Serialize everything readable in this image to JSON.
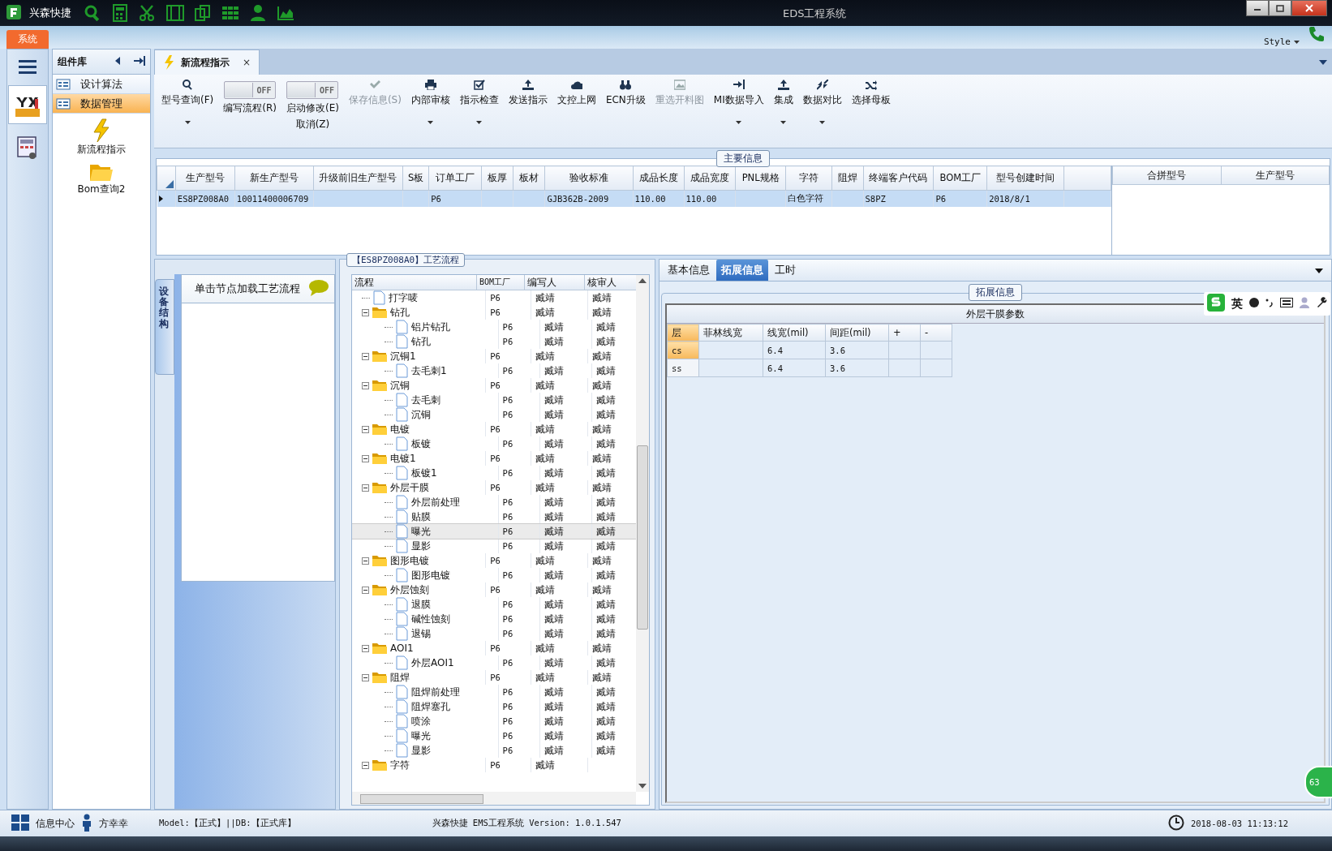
{
  "window": {
    "app_name": "兴森快捷",
    "title": "EDS工程系统"
  },
  "ribbon": {
    "tab": "系统",
    "style_label": "Style"
  },
  "component_panel": {
    "title": "组件库",
    "items": [
      {
        "label": "设计算法",
        "selected": false
      },
      {
        "label": "数据管理",
        "selected": true
      }
    ],
    "tools": [
      {
        "label": "新流程指示"
      },
      {
        "label": "Bom查询2"
      }
    ]
  },
  "doc_tab": {
    "label": "新流程指示",
    "close": "×"
  },
  "toolbar": [
    {
      "kind": "button",
      "label": "型号查询(F)",
      "disabled": false,
      "dropdown": true
    },
    {
      "kind": "toggle",
      "label": "编写流程(R)",
      "toggle_text": "OFF",
      "on": false
    },
    {
      "kind": "toggle",
      "label": "启动修改(E)",
      "label2": "取消(Z)",
      "toggle_text": "OFF",
      "on": false
    },
    {
      "kind": "button",
      "label": "保存信息(S)",
      "disabled": true,
      "dropdown": false
    },
    {
      "kind": "button",
      "label": "内部审核",
      "disabled": false,
      "dropdown": true
    },
    {
      "kind": "button",
      "label": "指示检查",
      "disabled": false,
      "dropdown": true
    },
    {
      "kind": "button",
      "label": "发送指示",
      "disabled": false,
      "dropdown": false
    },
    {
      "kind": "button",
      "label": "文控上网",
      "disabled": false,
      "dropdown": false
    },
    {
      "kind": "button",
      "label": "ECN升级",
      "disabled": false,
      "dropdown": false
    },
    {
      "kind": "button",
      "label": "重选开料图",
      "disabled": true,
      "dropdown": false
    },
    {
      "kind": "button",
      "label": "MI数据导入",
      "disabled": false,
      "dropdown": true
    },
    {
      "kind": "button",
      "label": "集成",
      "disabled": false,
      "dropdown": true
    },
    {
      "kind": "button",
      "label": "数据对比",
      "disabled": false,
      "dropdown": true
    },
    {
      "kind": "button",
      "label": "选择母板",
      "disabled": false,
      "dropdown": false
    }
  ],
  "main_info": {
    "title": "主要信息",
    "columns": [
      "生产型号",
      "新生产型号",
      "升级前旧生产型号",
      "S板",
      "订单工厂",
      "板厚",
      "板材",
      "验收标准",
      "成品长度",
      "成品宽度",
      "PNL规格",
      "字符",
      "阻焊",
      "终端客户代码",
      "BOM工厂",
      "型号创建时间"
    ],
    "rows": [
      {
        "selected": true,
        "cells": [
          "ES8PZ008A0",
          "10011400006709",
          "",
          "",
          "P6",
          "",
          "",
          "GJB362B-2009",
          "110.00",
          "110.00",
          "",
          "白色字符",
          "",
          "S8PZ",
          "P6",
          "2018/8/1"
        ]
      }
    ],
    "side_columns": [
      "合拼型号",
      "生产型号"
    ]
  },
  "equipment": {
    "side_tab": "设备结构",
    "header": "单击节点加载工艺流程"
  },
  "flow": {
    "title": "【ES8PZ008A0】工艺流程",
    "columns": [
      "流程",
      "BOM工厂",
      "编写人",
      "核审人"
    ],
    "tree": [
      {
        "kind": "file",
        "label": "打字唛",
        "bom": "P6",
        "writer": "臧靖",
        "reviewer": "臧靖",
        "selected": false
      },
      {
        "kind": "folder",
        "label": "钻孔",
        "bom": "P6",
        "writer": "臧靖",
        "reviewer": "臧靖",
        "selected": false,
        "expanded": true,
        "children": [
          {
            "kind": "file",
            "label": "铝片钻孔",
            "bom": "P6",
            "writer": "臧靖",
            "reviewer": "臧靖",
            "selected": false
          },
          {
            "kind": "file",
            "label": "钻孔",
            "bom": "P6",
            "writer": "臧靖",
            "reviewer": "臧靖",
            "selected": false
          }
        ]
      },
      {
        "kind": "folder",
        "label": "沉铜1",
        "bom": "P6",
        "writer": "臧靖",
        "reviewer": "臧靖",
        "selected": false,
        "expanded": true,
        "children": [
          {
            "kind": "file",
            "label": "去毛刺1",
            "bom": "P6",
            "writer": "臧靖",
            "reviewer": "臧靖",
            "selected": false
          }
        ]
      },
      {
        "kind": "folder",
        "label": "沉铜",
        "bom": "P6",
        "writer": "臧靖",
        "reviewer": "臧靖",
        "selected": false,
        "expanded": true,
        "children": [
          {
            "kind": "file",
            "label": "去毛刺",
            "bom": "P6",
            "writer": "臧靖",
            "reviewer": "臧靖",
            "selected": false
          },
          {
            "kind": "file",
            "label": "沉铜",
            "bom": "P6",
            "writer": "臧靖",
            "reviewer": "臧靖",
            "selected": false
          }
        ]
      },
      {
        "kind": "folder",
        "label": "电镀",
        "bom": "P6",
        "writer": "臧靖",
        "reviewer": "臧靖",
        "selected": false,
        "expanded": true,
        "children": [
          {
            "kind": "file",
            "label": "板镀",
            "bom": "P6",
            "writer": "臧靖",
            "reviewer": "臧靖",
            "selected": false
          }
        ]
      },
      {
        "kind": "folder",
        "label": "电镀1",
        "bom": "P6",
        "writer": "臧靖",
        "reviewer": "臧靖",
        "selected": false,
        "expanded": true,
        "children": [
          {
            "kind": "file",
            "label": "板镀1",
            "bom": "P6",
            "writer": "臧靖",
            "reviewer": "臧靖",
            "selected": false
          }
        ]
      },
      {
        "kind": "folder",
        "label": "外层干膜",
        "bom": "P6",
        "writer": "臧靖",
        "reviewer": "臧靖",
        "selected": false,
        "expanded": true,
        "children": [
          {
            "kind": "file",
            "label": "外层前处理",
            "bom": "P6",
            "writer": "臧靖",
            "reviewer": "臧靖",
            "selected": false
          },
          {
            "kind": "file",
            "label": "贴膜",
            "bom": "P6",
            "writer": "臧靖",
            "reviewer": "臧靖",
            "selected": false
          },
          {
            "kind": "file",
            "label": "曝光",
            "bom": "P6",
            "writer": "臧靖",
            "reviewer": "臧靖",
            "selected": true
          },
          {
            "kind": "file",
            "label": "显影",
            "bom": "P6",
            "writer": "臧靖",
            "reviewer": "臧靖",
            "selected": false
          }
        ]
      },
      {
        "kind": "folder",
        "label": "图形电镀",
        "bom": "P6",
        "writer": "臧靖",
        "reviewer": "臧靖",
        "selected": false,
        "expanded": true,
        "children": [
          {
            "kind": "file",
            "label": "图形电镀",
            "bom": "P6",
            "writer": "臧靖",
            "reviewer": "臧靖",
            "selected": false
          }
        ]
      },
      {
        "kind": "folder",
        "label": "外层蚀刻",
        "bom": "P6",
        "writer": "臧靖",
        "reviewer": "臧靖",
        "selected": false,
        "expanded": true,
        "children": [
          {
            "kind": "file",
            "label": "退膜",
            "bom": "P6",
            "writer": "臧靖",
            "reviewer": "臧靖",
            "selected": false
          },
          {
            "kind": "file",
            "label": "碱性蚀刻",
            "bom": "P6",
            "writer": "臧靖",
            "reviewer": "臧靖",
            "selected": false
          },
          {
            "kind": "file",
            "label": "退锡",
            "bom": "P6",
            "writer": "臧靖",
            "reviewer": "臧靖",
            "selected": false
          }
        ]
      },
      {
        "kind": "folder",
        "label": "AOI1",
        "bom": "P6",
        "writer": "臧靖",
        "reviewer": "臧靖",
        "selected": false,
        "expanded": true,
        "children": [
          {
            "kind": "file",
            "label": "外层AOI1",
            "bom": "P6",
            "writer": "臧靖",
            "reviewer": "臧靖",
            "selected": false
          }
        ]
      },
      {
        "kind": "folder",
        "label": "阻焊",
        "bom": "P6",
        "writer": "臧靖",
        "reviewer": "臧靖",
        "selected": false,
        "expanded": true,
        "children": [
          {
            "kind": "file",
            "label": "阻焊前处理",
            "bom": "P6",
            "writer": "臧靖",
            "reviewer": "臧靖",
            "selected": false
          },
          {
            "kind": "file",
            "label": "阻焊塞孔",
            "bom": "P6",
            "writer": "臧靖",
            "reviewer": "臧靖",
            "selected": false
          },
          {
            "kind": "file",
            "label": "喷涂",
            "bom": "P6",
            "writer": "臧靖",
            "reviewer": "臧靖",
            "selected": false
          },
          {
            "kind": "file",
            "label": "曝光",
            "bom": "P6",
            "writer": "臧靖",
            "reviewer": "臧靖",
            "selected": false
          },
          {
            "kind": "file",
            "label": "显影",
            "bom": "P6",
            "writer": "臧靖",
            "reviewer": "臧靖",
            "selected": false
          }
        ]
      },
      {
        "kind": "folder",
        "label": "字符",
        "bom": "P6",
        "writer": "臧靖",
        "selected": false,
        "expanded": true
      }
    ]
  },
  "detail": {
    "tabs": [
      {
        "label": "基本信息",
        "selected": false
      },
      {
        "label": "拓展信息",
        "selected": true
      },
      {
        "label": "工时",
        "selected": false
      }
    ],
    "group_title": "拓展信息",
    "grid_title": "外层干膜参数",
    "columns": [
      "层",
      "菲林线宽",
      "线宽(mil)",
      "间距(mil)",
      "+",
      "-"
    ],
    "rows": [
      {
        "selected": true,
        "cells": [
          "cs",
          "",
          "6.4",
          "3.6",
          "",
          ""
        ]
      },
      {
        "selected": false,
        "cells": [
          "ss",
          "",
          "6.4",
          "3.6",
          "",
          ""
        ]
      }
    ]
  },
  "ime_bar": {
    "mode": "英"
  },
  "side_badge": "63",
  "status_bar": {
    "info_center": "信息中心",
    "user": "方幸幸",
    "model": "Model:【正式】||DB:【正式库】",
    "version": "兴森快捷 EMS工程系统 Version: 1.0.1.547",
    "datetime": "2018-08-03 11:13:12"
  }
}
